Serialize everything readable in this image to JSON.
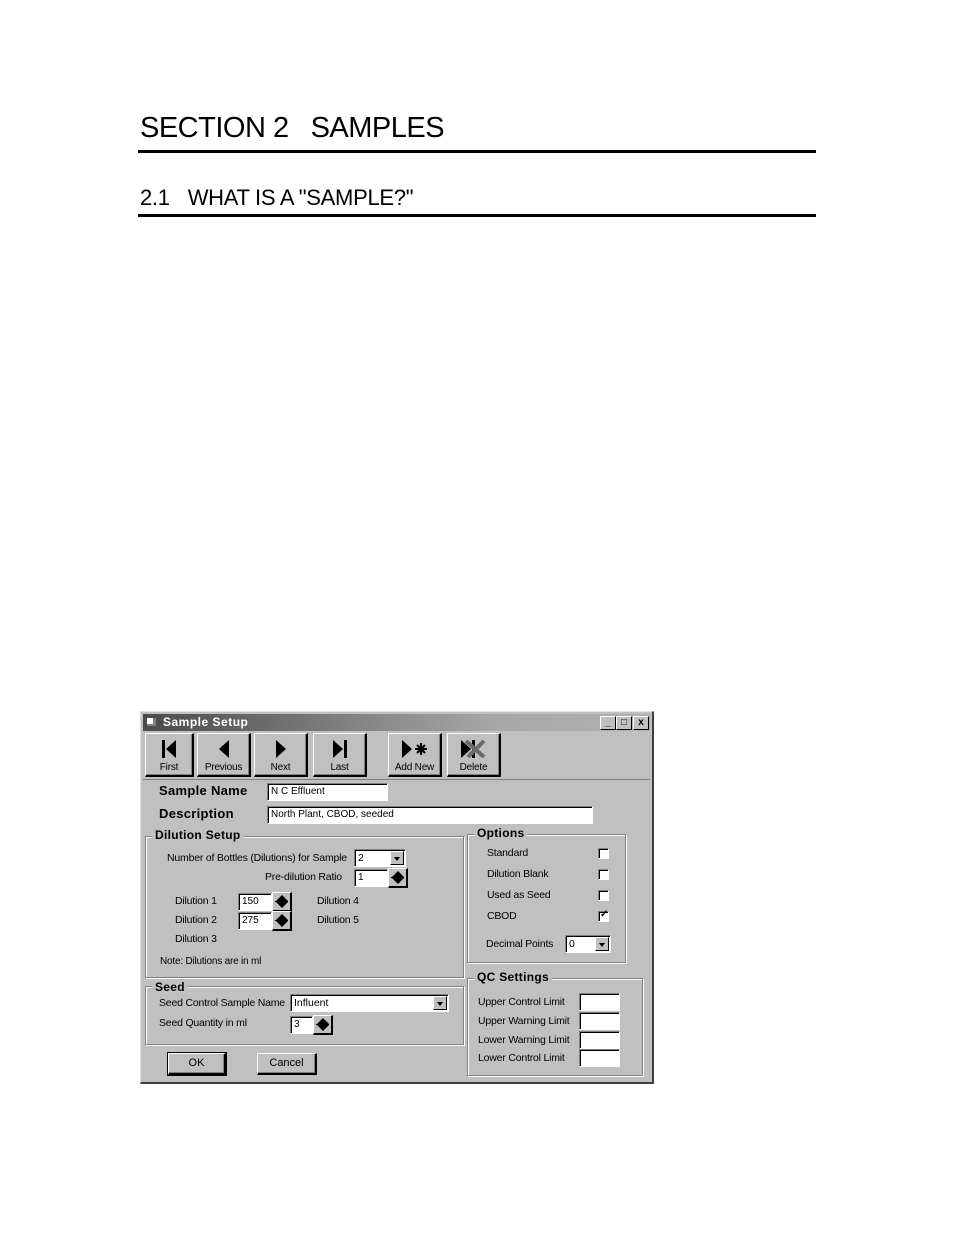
{
  "document": {
    "section_number": "SECTION 2",
    "section_title": "SAMPLES",
    "subsection_number": "2.1",
    "subsection_title": "WHAT IS A \"SAMPLE?\""
  },
  "dialog": {
    "title": "Sample Setup",
    "window_controls": {
      "minimize": "_",
      "maximize": "□",
      "close": "x"
    },
    "toolbar": [
      {
        "label": "First",
        "icon": "first-record-icon"
      },
      {
        "label": "Previous",
        "icon": "previous-record-icon"
      },
      {
        "label": "Next",
        "icon": "next-record-icon"
      },
      {
        "label": "Last",
        "icon": "last-record-icon"
      },
      {
        "label": "Add New",
        "icon": "add-new-icon"
      },
      {
        "label": "Delete",
        "icon": "delete-icon"
      }
    ],
    "sample_name": {
      "label": "Sample Name",
      "value": "N C Effluent"
    },
    "description": {
      "label": "Description",
      "value": "North Plant, CBOD, seeded"
    },
    "dilution_setup": {
      "title": "Dilution Setup",
      "bottles_label": "Number of Bottles (Dilutions) for Sample",
      "bottles_value": "2",
      "predilution_label": "Pre-dilution Ratio",
      "predilution_value": "1",
      "dilutions": [
        {
          "label": "Dilution 1",
          "value": "150"
        },
        {
          "label": "Dilution 2",
          "value": "275"
        },
        {
          "label": "Dilution 3",
          "value": ""
        },
        {
          "label": "Dilution 4",
          "value": ""
        },
        {
          "label": "Dilution 5",
          "value": ""
        }
      ],
      "note": "Note: Dilutions are in ml"
    },
    "options": {
      "title": "Options",
      "checkboxes": [
        {
          "label": "Standard",
          "checked": false
        },
        {
          "label": "Dilution Blank",
          "checked": false
        },
        {
          "label": "Used as Seed",
          "checked": false
        },
        {
          "label": "CBOD",
          "checked": true
        }
      ],
      "decimal_points_label": "Decimal Points",
      "decimal_points_value": "0"
    },
    "seed": {
      "title": "Seed",
      "control_label": "Seed Control Sample Name",
      "control_value": "Influent",
      "quantity_label": "Seed Quantity in ml",
      "quantity_value": "3"
    },
    "qc_settings": {
      "title": "QC Settings",
      "fields": [
        {
          "label": "Upper Control Limit",
          "value": ""
        },
        {
          "label": "Upper Warning Limit",
          "value": ""
        },
        {
          "label": "Lower Warning Limit",
          "value": ""
        },
        {
          "label": "Lower Control Limit",
          "value": ""
        }
      ]
    },
    "ok_label": "OK",
    "cancel_label": "Cancel"
  }
}
